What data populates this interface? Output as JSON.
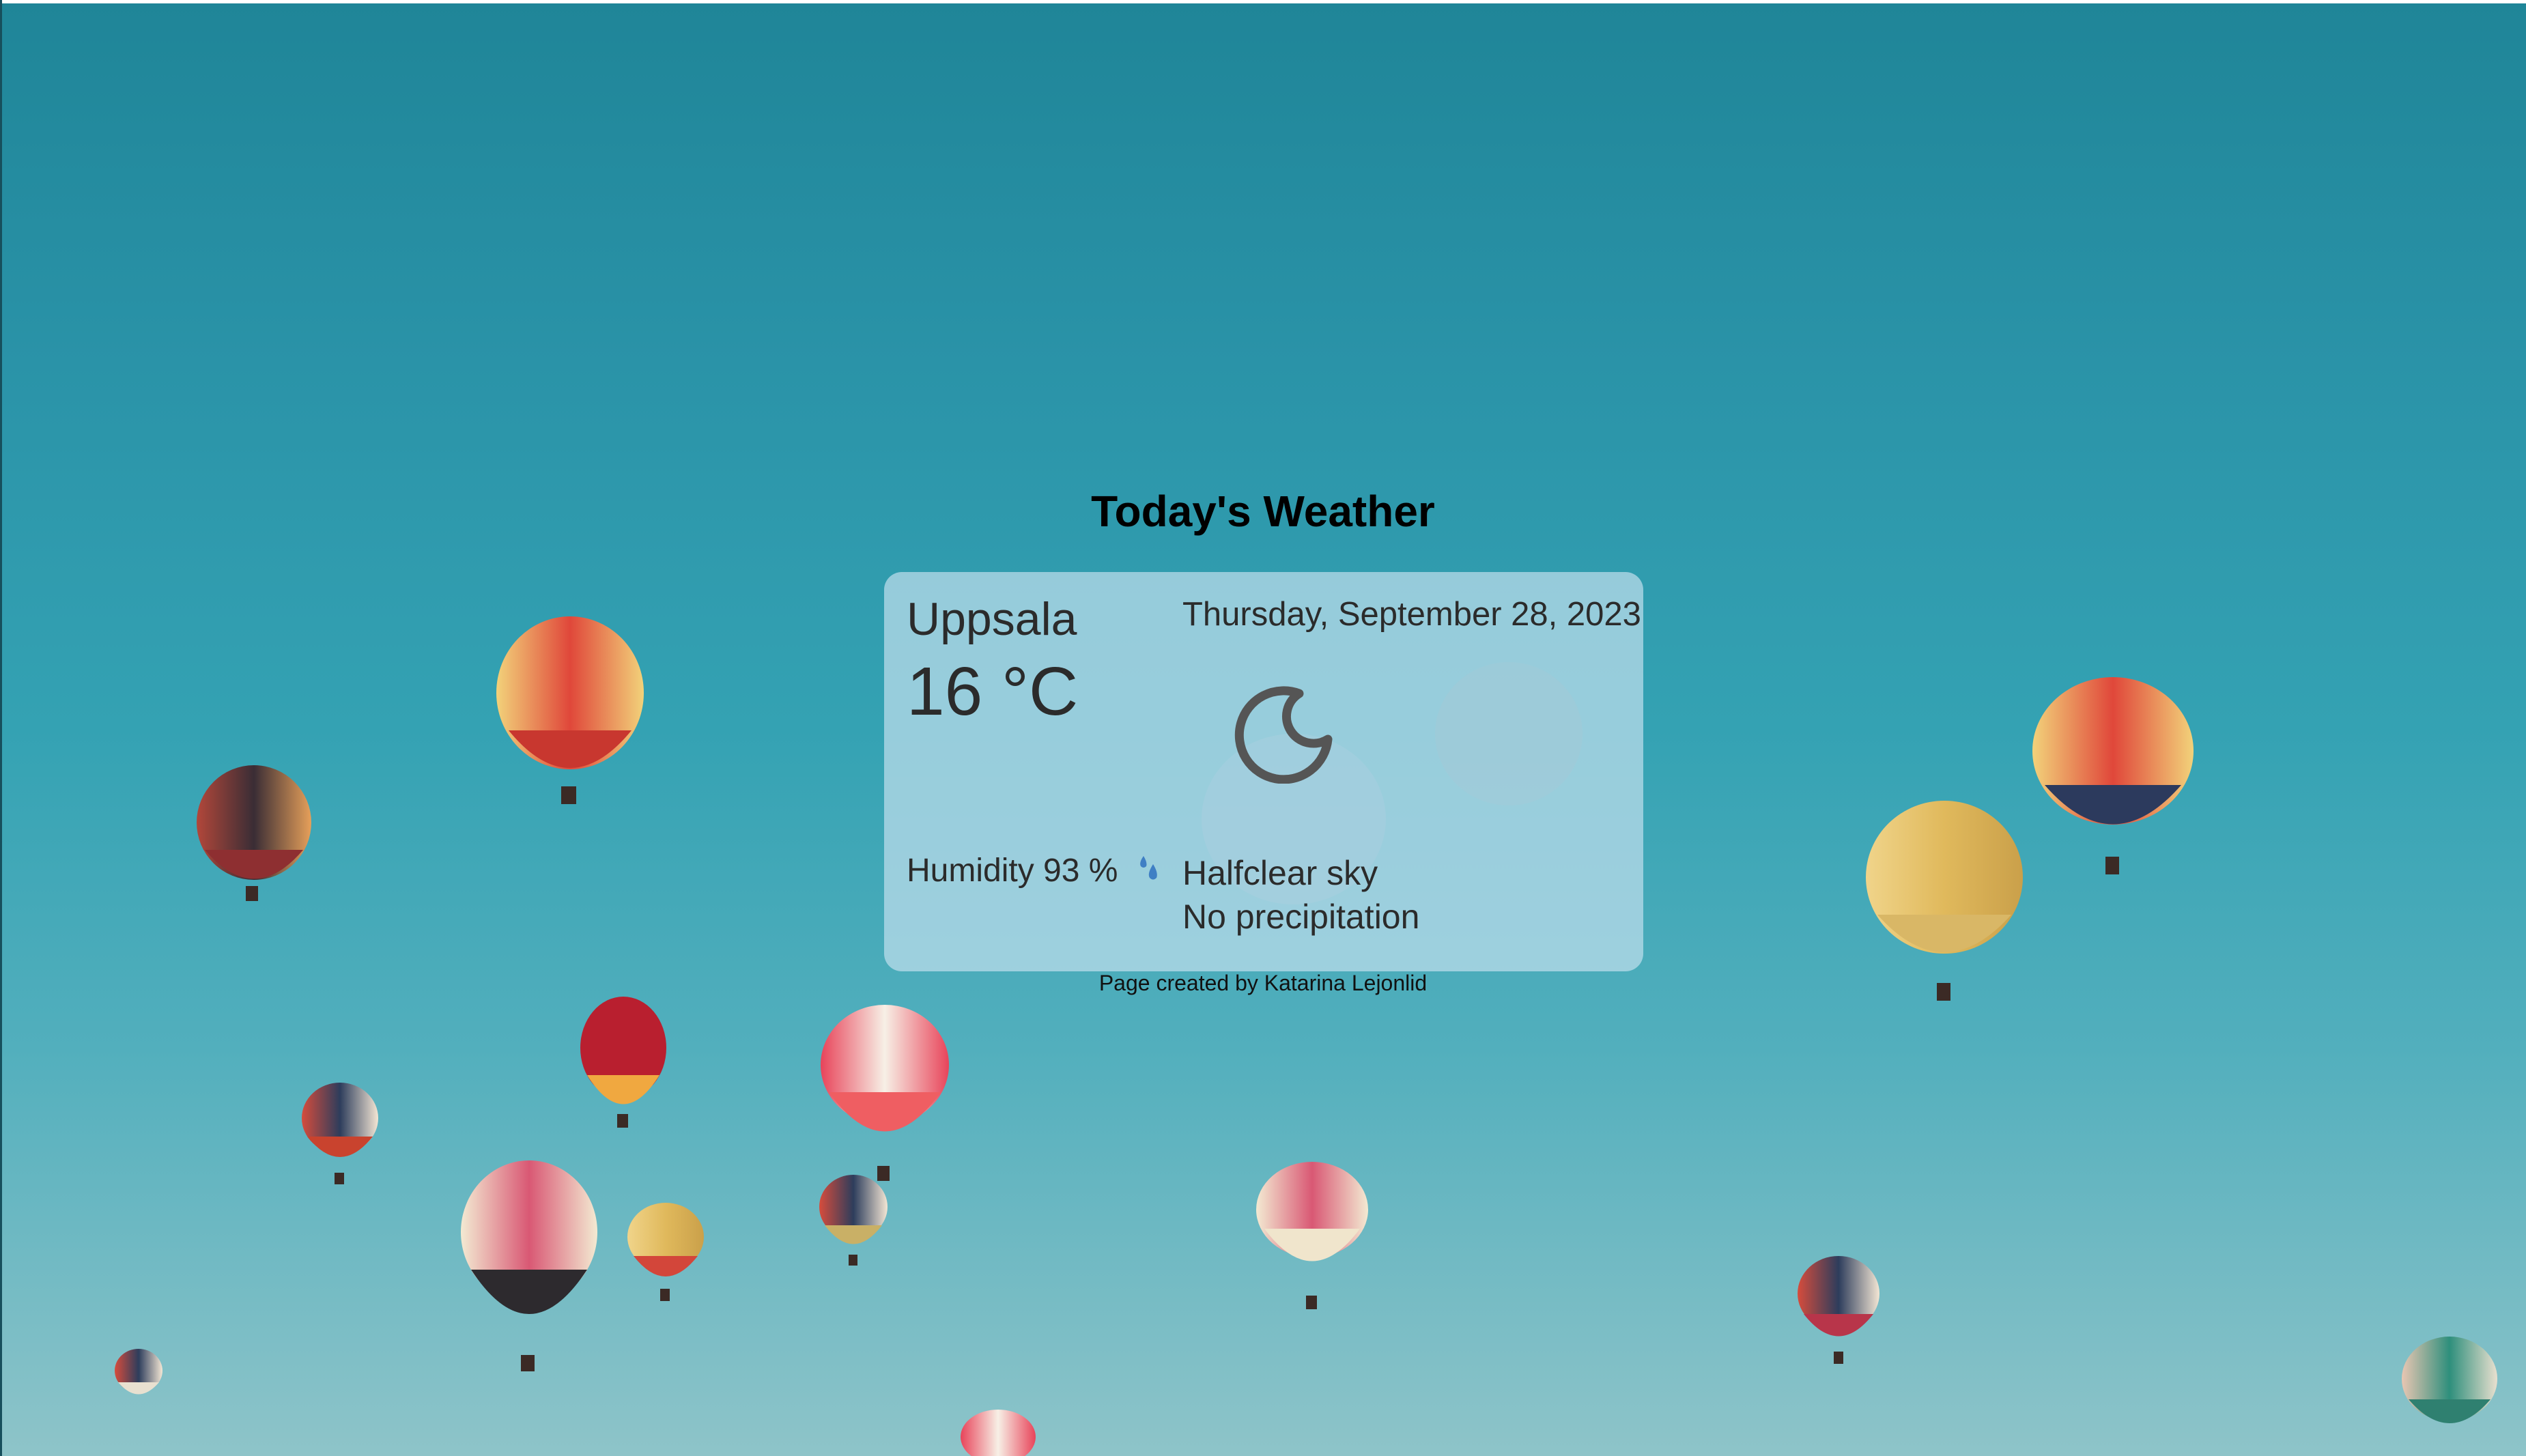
{
  "page": {
    "title": "Today's Weather",
    "footer": "Page created by Katarina Lejonlid"
  },
  "weather": {
    "city": "Uppsala",
    "temperature": "16 °C",
    "date": "Thursday, September 28, 2023",
    "humidity": "Humidity 93 %",
    "condition": "Halfclear sky",
    "precipitation": "No precipitation",
    "condition_icon": "halfclear-sky-icon",
    "humidity_icon": "humidity-drops-icon"
  },
  "colors": {
    "sky_top": "#1f8598",
    "sky_bottom": "#8ec4c9",
    "card_bg": "#bedeec",
    "icon_gray": "#555555",
    "drop_blue": "#3f7fc4"
  }
}
